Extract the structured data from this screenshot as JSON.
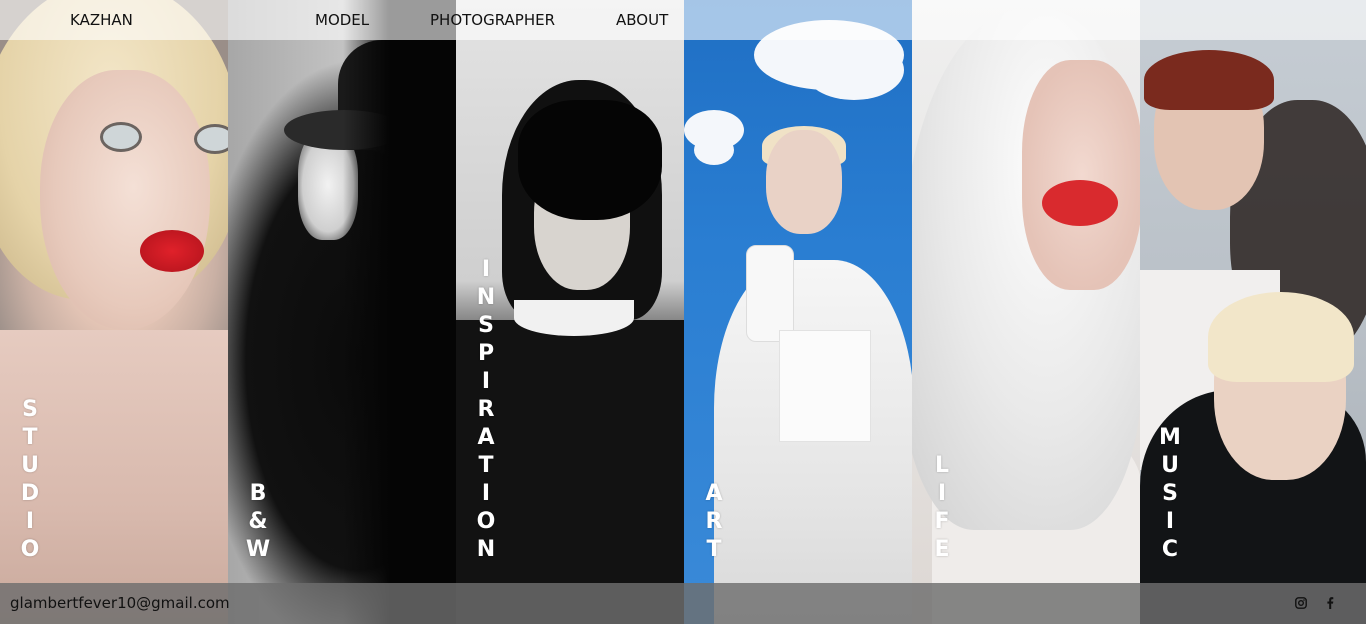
{
  "nav": {
    "brand": "KAZHAN",
    "items": [
      "MODEL",
      "PHOTOGRAPHER",
      "ABOUT"
    ]
  },
  "panels": [
    {
      "label": [
        "S",
        "T",
        "U",
        "D",
        "I",
        "O"
      ]
    },
    {
      "label": [
        "B",
        "&",
        "W"
      ]
    },
    {
      "label": [
        "I",
        "N",
        "S",
        "P",
        "I",
        "R",
        "A",
        "T",
        "I",
        "O",
        "N"
      ]
    },
    {
      "label": [
        "A",
        "R",
        "T"
      ]
    },
    {
      "label": [
        "L",
        "I",
        "F",
        "E"
      ]
    },
    {
      "label": [
        "M",
        "U",
        "S",
        "I",
        "C"
      ]
    }
  ],
  "footer": {
    "email": "glambertfever10@gmail.com",
    "social": [
      {
        "icon": "instagram-icon"
      },
      {
        "icon": "facebook-icon"
      }
    ]
  },
  "colors": {
    "label_text": "#ffffff",
    "nav_text": "#111111",
    "footer_bg": "#6e6e6e"
  }
}
